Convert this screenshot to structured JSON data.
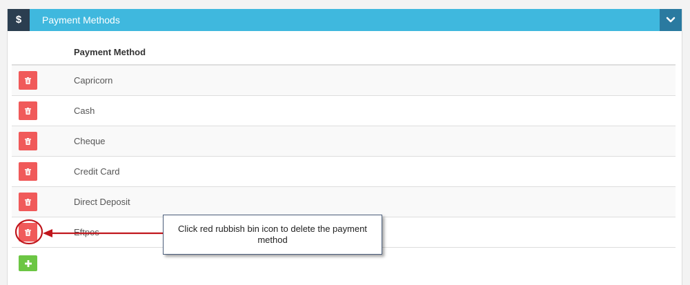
{
  "header": {
    "icon_glyph": "$",
    "title": "Payment Methods",
    "collapse_icon": "chevron-down-icon",
    "color": "#3fb8de",
    "icon_box_color": "#2b3e50",
    "collapse_color": "#2a7aa0"
  },
  "table": {
    "column_header": "Payment Method",
    "rows": [
      {
        "label": "Capricorn"
      },
      {
        "label": "Cash"
      },
      {
        "label": "Cheque"
      },
      {
        "label": "Credit Card"
      },
      {
        "label": "Direct Deposit"
      },
      {
        "label": "Eftpos"
      }
    ],
    "delete_icon": "trash-icon",
    "delete_color": "#f05a5a",
    "add_icon": "plus-icon",
    "add_color": "#6cc644"
  },
  "annotation": {
    "text": "Click red rubbish bin icon to delete the payment method",
    "arrow_color": "#c0161c"
  }
}
